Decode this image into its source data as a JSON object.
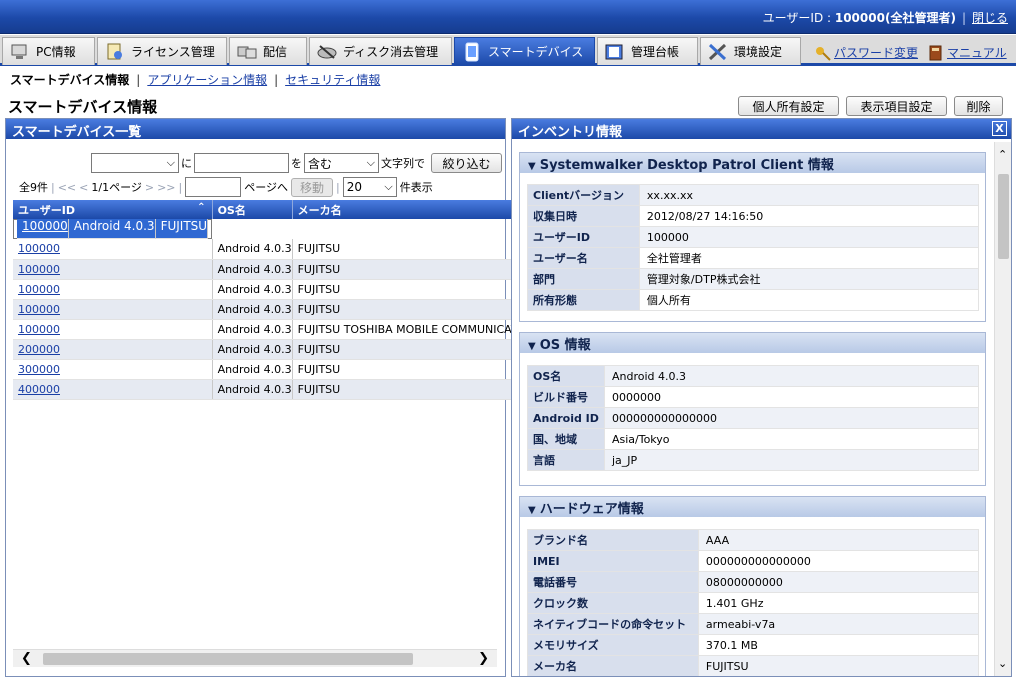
{
  "header": {
    "user_text": "ユーザーID : ",
    "user_value": "100000(全社管理者)",
    "logout": "閉じる"
  },
  "tabs": [
    {
      "label": "PC情報",
      "icon": "pc-icon"
    },
    {
      "label": "ライセンス管理",
      "icon": "license-icon"
    },
    {
      "label": "配信",
      "icon": "distribution-icon"
    },
    {
      "label": "ディスク消去管理",
      "icon": "disk-erase-icon"
    },
    {
      "label": "スマートデバイス",
      "icon": "smartphone-icon",
      "active": true
    },
    {
      "label": "管理台帳",
      "icon": "ledger-icon"
    },
    {
      "label": "環境設定",
      "icon": "tools-icon"
    }
  ],
  "tab_links": {
    "password": "パスワード変更",
    "manual": "マニュアル"
  },
  "subnav": {
    "current": "スマートデバイス情報",
    "app": "アプリケーション情報",
    "security": "セキュリティ情報"
  },
  "page_title": "スマートデバイス情報",
  "actions": {
    "personal": "個人所有設定",
    "columns": "表示項目設定",
    "delete": "削除"
  },
  "list_panel": {
    "title": "スマートデバイス一覧",
    "filter": {
      "field_value": "",
      "ni": "に",
      "text_value": "",
      "wo": "を",
      "mode_value": "含む",
      "mojiretsu": "文字列で",
      "button": "絞り込む"
    },
    "pager": {
      "total": "全9件",
      "sep1": "|",
      "first": "<<",
      "prev": "<",
      "page_info": "1/1ページ",
      "next": ">",
      "last": ">>",
      "sep2": "|",
      "page_input": "",
      "page_suffix": "ページへ",
      "go": "移動",
      "sep3": "|",
      "per_page": "20",
      "per_page_suffix": "件表示"
    },
    "columns": [
      "ユーザーID",
      "OS名",
      "メーカ名"
    ],
    "rows": [
      {
        "user": "100000",
        "os": "Android 4.0.3",
        "maker": "FUJITSU"
      },
      {
        "user": "100000",
        "os": "Android 4.0.3",
        "maker": "FUJITSU"
      },
      {
        "user": "100000",
        "os": "Android 4.0.3",
        "maker": "FUJITSU"
      },
      {
        "user": "100000",
        "os": "Android 4.0.3",
        "maker": "FUJITSU"
      },
      {
        "user": "100000",
        "os": "Android 4.0.3",
        "maker": "FUJITSU"
      },
      {
        "user": "100000",
        "os": "Android 4.0.3",
        "maker": "FUJITSU TOSHIBA MOBILE COMMUNICATIONS"
      },
      {
        "user": "200000",
        "os": "Android 4.0.3",
        "maker": "FUJITSU"
      },
      {
        "user": "300000",
        "os": "Android 4.0.3",
        "maker": "FUJITSU"
      },
      {
        "user": "400000",
        "os": "Android 4.0.3",
        "maker": "FUJITSU"
      }
    ]
  },
  "inventory_panel": {
    "title": "インベントリ情報",
    "close": "X",
    "sections": [
      {
        "title": "Systemwalker Desktop Patrol Client 情報",
        "rows": [
          {
            "k": "Clientバージョン",
            "v": "xx.xx.xx"
          },
          {
            "k": "収集日時",
            "v": "2012/08/27 14:16:50"
          },
          {
            "k": "ユーザーID",
            "v": "100000"
          },
          {
            "k": "ユーザー名",
            "v": "全社管理者"
          },
          {
            "k": "部門",
            "v": "管理対象/DTP株式会社"
          },
          {
            "k": "所有形態",
            "v": "個人所有"
          }
        ]
      },
      {
        "title": "OS 情報",
        "rows": [
          {
            "k": "OS名",
            "v": "Android 4.0.3"
          },
          {
            "k": "ビルド番号",
            "v": "0000000"
          },
          {
            "k": "Android ID",
            "v": "000000000000000"
          },
          {
            "k": "国、地域",
            "v": "Asia/Tokyo"
          },
          {
            "k": "言語",
            "v": "ja_JP"
          }
        ]
      },
      {
        "title": "ハードウェア情報",
        "rows": [
          {
            "k": "ブランド名",
            "v": "AAA"
          },
          {
            "k": "IMEI",
            "v": "000000000000000"
          },
          {
            "k": "電話番号",
            "v": "08000000000"
          },
          {
            "k": "クロック数",
            "v": "1.401 GHz"
          },
          {
            "k": "ネイティブコードの命令セット",
            "v": "armeabi-v7a"
          },
          {
            "k": "メモリサイズ",
            "v": "370.1 MB"
          },
          {
            "k": "メーカ名",
            "v": "FUJITSU"
          }
        ]
      }
    ]
  }
}
